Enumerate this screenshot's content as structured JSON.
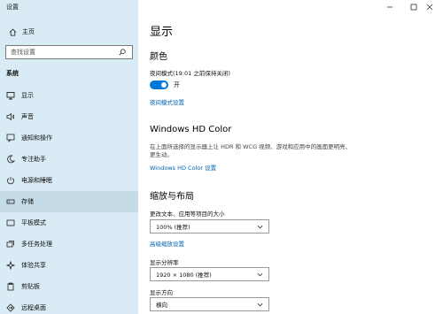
{
  "window": {
    "title": "设置"
  },
  "sidebar": {
    "home_label": "主页",
    "search_placeholder": "查找设置",
    "section_header": "系统",
    "items": [
      {
        "label": "显示",
        "icon": "monitor-icon",
        "selected": false
      },
      {
        "label": "声音",
        "icon": "speaker-icon",
        "selected": false
      },
      {
        "label": "通知和操作",
        "icon": "notification-icon",
        "selected": false
      },
      {
        "label": "专注助手",
        "icon": "moon-icon",
        "selected": false
      },
      {
        "label": "电源和睡眠",
        "icon": "power-icon",
        "selected": false
      },
      {
        "label": "存储",
        "icon": "storage-icon",
        "selected": true
      },
      {
        "label": "平板模式",
        "icon": "tablet-icon",
        "selected": false
      },
      {
        "label": "多任务处理",
        "icon": "multitask-icon",
        "selected": false
      },
      {
        "label": "体验共享",
        "icon": "share-icon",
        "selected": false
      },
      {
        "label": "剪贴板",
        "icon": "clipboard-icon",
        "selected": false
      },
      {
        "label": "远程桌面",
        "icon": "remote-desktop-icon",
        "selected": false
      }
    ]
  },
  "main": {
    "title": "显示",
    "color_section": {
      "heading": "颜色",
      "night_mode_label": "夜间模式(19:01 之前保持关闭)",
      "toggle_state": "开",
      "toggle_on": true,
      "night_settings_link": "夜间模式设置"
    },
    "hd_color": {
      "heading": "Windows HD Color",
      "description": "在上面所选择的显示器上让 HDR 和 WCG 视频、游戏和应用中的画面更明亮、更生动。",
      "link": "Windows HD Color 设置"
    },
    "scale_layout": {
      "heading": "缩放与布局",
      "scale_label": "更改文本、应用等项目的大小",
      "scale_value": "100% (推荐)",
      "advanced_link": "高级缩放设置",
      "resolution_label": "显示分辨率",
      "resolution_value": "1920 × 1080 (推荐)",
      "orientation_label": "显示方向",
      "orientation_value": "横向"
    }
  },
  "colors": {
    "sidebar_bg": "#d9ebf4",
    "accent": "#0078d7",
    "link": "#0063b1"
  }
}
